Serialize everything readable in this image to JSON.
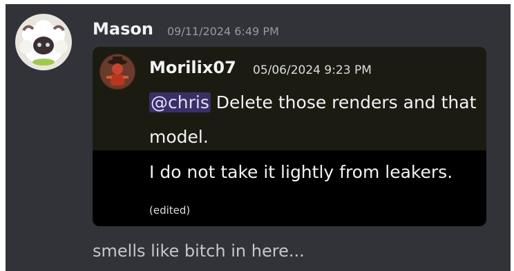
{
  "message": {
    "author": "Mason",
    "timestamp": "09/11/2024 6:49 PM",
    "text": "smells like bitch in here..."
  },
  "quoted": {
    "author": "Morilix07",
    "timestamp": "05/06/2024 9:23 PM",
    "mention": "@chris",
    "line1": " Delete those renders and that model.",
    "line2": "I do not take it lightly from leakers.",
    "edited": "(edited)"
  },
  "icons": {
    "author_avatar": "sheep-avatar",
    "quoted_avatar": "red-character-avatar"
  }
}
